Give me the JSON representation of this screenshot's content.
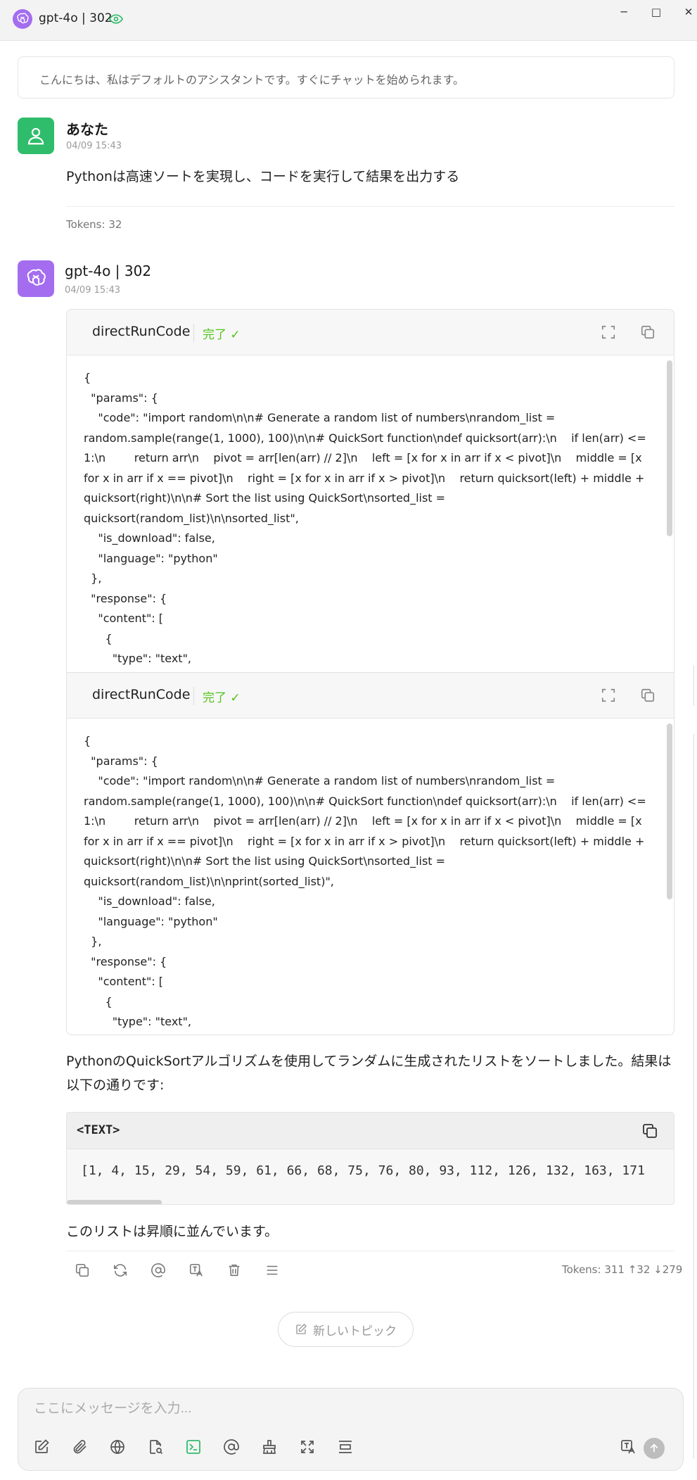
{
  "window": {
    "title": "gpt-4o | 302",
    "controls": {
      "minimize": "─",
      "maximize": "□",
      "close": "✕"
    }
  },
  "system_notice": "こんにちは、私はデフォルトのアシスタントです。すぐにチャットを始められます。",
  "user_message": {
    "name": "あなた",
    "time": "04/09 15:43",
    "text": "Pythonは高速ソートを実現し、コードを実行して結果を出力する",
    "tokens": "Tokens: 32"
  },
  "assistant_message": {
    "name": "gpt-4o | 302",
    "time": "04/09 15:43",
    "tool_calls": [
      {
        "name": "directRunCode",
        "status": "完了 ✓",
        "body": "{\n  \"params\": {\n    \"code\": \"import random\\n\\n# Generate a random list of numbers\\nrandom_list = random.sample(range(1, 1000), 100)\\n\\n# QuickSort function\\ndef quicksort(arr):\\n    if len(arr) <= 1:\\n        return arr\\n    pivot = arr[len(arr) // 2]\\n    left = [x for x in arr if x < pivot]\\n    middle = [x for x in arr if x == pivot]\\n    right = [x for x in arr if x > pivot]\\n    return quicksort(left) + middle + quicksort(right)\\n\\n# Sort the list using QuickSort\\nsorted_list = quicksort(random_list)\\n\\nsorted_list\",\n    \"is_download\": false,\n    \"language\": \"python\"\n  },\n  \"response\": {\n    \"content\": [\n      {\n        \"type\": \"text\","
      },
      {
        "name": "directRunCode",
        "status": "完了 ✓",
        "body": "{\n  \"params\": {\n    \"code\": \"import random\\n\\n# Generate a random list of numbers\\nrandom_list = random.sample(range(1, 1000), 100)\\n\\n# QuickSort function\\ndef quicksort(arr):\\n    if len(arr) <= 1:\\n        return arr\\n    pivot = arr[len(arr) // 2]\\n    left = [x for x in arr if x < pivot]\\n    middle = [x for x in arr if x == pivot]\\n    right = [x for x in arr if x > pivot]\\n    return quicksort(left) + middle + quicksort(right)\\n\\n# Sort the list using QuickSort\\nsorted_list = quicksort(random_list)\\n\\nprint(sorted_list)\",\n    \"is_download\": false,\n    \"language\": \"python\"\n  },\n  \"response\": {\n    \"content\": [\n      {\n        \"type\": \"text\","
      }
    ],
    "text_before": "PythonのQuickSortアルゴリズムを使用してランダムに生成されたリストをソートしました。結果は以下の通りです:",
    "code_block": {
      "language": "<TEXT>",
      "content": "[1, 4, 15, 29, 54, 59, 61, 66, 68, 75, 76, 80, 93, 112, 126, 132, 163, 171"
    },
    "text_after": "このリストは昇順に並んでいます。",
    "tokens": "Tokens: 311 ↑32 ↓279",
    "actions": [
      "copy-icon",
      "regenerate-icon",
      "mention-icon",
      "translate-icon",
      "delete-icon",
      "menu-icon"
    ]
  },
  "new_topic_label": "新しいトピック",
  "composer": {
    "placeholder": "ここにメッセージを入力...",
    "tools": [
      "edit-icon",
      "attach-icon",
      "web-search-icon",
      "knowledge-icon",
      "code-run-icon",
      "mention-icon",
      "cleanup-icon",
      "expand-icon",
      "layout-icon"
    ],
    "active_tool": "code-run-icon",
    "accent_color": "#2fbd6b"
  },
  "colors": {
    "user_avatar": "#2fbd6b",
    "assistant_avatar": "#a46df0",
    "status_green": "#52c41a"
  }
}
